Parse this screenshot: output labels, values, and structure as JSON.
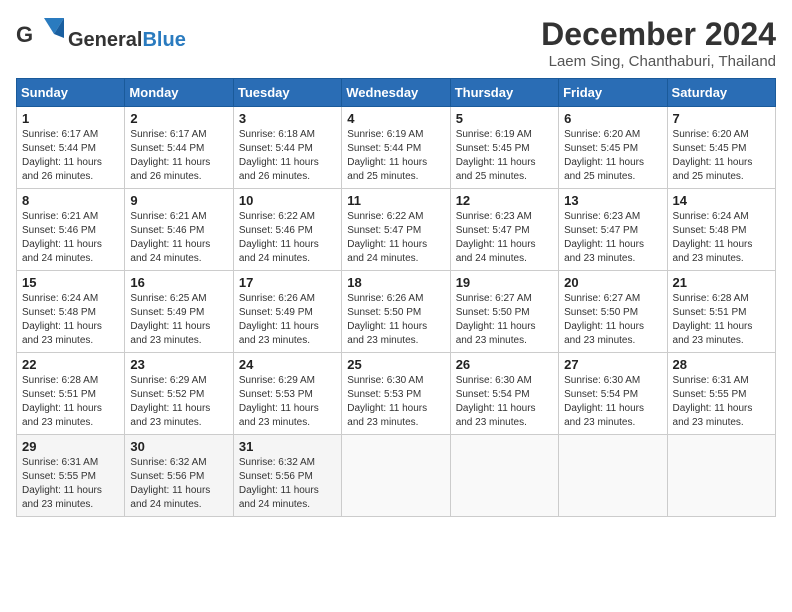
{
  "header": {
    "logo_general": "General",
    "logo_blue": "Blue",
    "month_year": "December 2024",
    "location": "Laem Sing, Chanthaburi, Thailand"
  },
  "calendar": {
    "days_of_week": [
      "Sunday",
      "Monday",
      "Tuesday",
      "Wednesday",
      "Thursday",
      "Friday",
      "Saturday"
    ],
    "weeks": [
      [
        {
          "day": "1",
          "info": "Sunrise: 6:17 AM\nSunset: 5:44 PM\nDaylight: 11 hours\nand 26 minutes."
        },
        {
          "day": "2",
          "info": "Sunrise: 6:17 AM\nSunset: 5:44 PM\nDaylight: 11 hours\nand 26 minutes."
        },
        {
          "day": "3",
          "info": "Sunrise: 6:18 AM\nSunset: 5:44 PM\nDaylight: 11 hours\nand 26 minutes."
        },
        {
          "day": "4",
          "info": "Sunrise: 6:19 AM\nSunset: 5:44 PM\nDaylight: 11 hours\nand 25 minutes."
        },
        {
          "day": "5",
          "info": "Sunrise: 6:19 AM\nSunset: 5:45 PM\nDaylight: 11 hours\nand 25 minutes."
        },
        {
          "day": "6",
          "info": "Sunrise: 6:20 AM\nSunset: 5:45 PM\nDaylight: 11 hours\nand 25 minutes."
        },
        {
          "day": "7",
          "info": "Sunrise: 6:20 AM\nSunset: 5:45 PM\nDaylight: 11 hours\nand 25 minutes."
        }
      ],
      [
        {
          "day": "8",
          "info": "Sunrise: 6:21 AM\nSunset: 5:46 PM\nDaylight: 11 hours\nand 24 minutes."
        },
        {
          "day": "9",
          "info": "Sunrise: 6:21 AM\nSunset: 5:46 PM\nDaylight: 11 hours\nand 24 minutes."
        },
        {
          "day": "10",
          "info": "Sunrise: 6:22 AM\nSunset: 5:46 PM\nDaylight: 11 hours\nand 24 minutes."
        },
        {
          "day": "11",
          "info": "Sunrise: 6:22 AM\nSunset: 5:47 PM\nDaylight: 11 hours\nand 24 minutes."
        },
        {
          "day": "12",
          "info": "Sunrise: 6:23 AM\nSunset: 5:47 PM\nDaylight: 11 hours\nand 24 minutes."
        },
        {
          "day": "13",
          "info": "Sunrise: 6:23 AM\nSunset: 5:47 PM\nDaylight: 11 hours\nand 23 minutes."
        },
        {
          "day": "14",
          "info": "Sunrise: 6:24 AM\nSunset: 5:48 PM\nDaylight: 11 hours\nand 23 minutes."
        }
      ],
      [
        {
          "day": "15",
          "info": "Sunrise: 6:24 AM\nSunset: 5:48 PM\nDaylight: 11 hours\nand 23 minutes."
        },
        {
          "day": "16",
          "info": "Sunrise: 6:25 AM\nSunset: 5:49 PM\nDaylight: 11 hours\nand 23 minutes."
        },
        {
          "day": "17",
          "info": "Sunrise: 6:26 AM\nSunset: 5:49 PM\nDaylight: 11 hours\nand 23 minutes."
        },
        {
          "day": "18",
          "info": "Sunrise: 6:26 AM\nSunset: 5:50 PM\nDaylight: 11 hours\nand 23 minutes."
        },
        {
          "day": "19",
          "info": "Sunrise: 6:27 AM\nSunset: 5:50 PM\nDaylight: 11 hours\nand 23 minutes."
        },
        {
          "day": "20",
          "info": "Sunrise: 6:27 AM\nSunset: 5:50 PM\nDaylight: 11 hours\nand 23 minutes."
        },
        {
          "day": "21",
          "info": "Sunrise: 6:28 AM\nSunset: 5:51 PM\nDaylight: 11 hours\nand 23 minutes."
        }
      ],
      [
        {
          "day": "22",
          "info": "Sunrise: 6:28 AM\nSunset: 5:51 PM\nDaylight: 11 hours\nand 23 minutes."
        },
        {
          "day": "23",
          "info": "Sunrise: 6:29 AM\nSunset: 5:52 PM\nDaylight: 11 hours\nand 23 minutes."
        },
        {
          "day": "24",
          "info": "Sunrise: 6:29 AM\nSunset: 5:53 PM\nDaylight: 11 hours\nand 23 minutes."
        },
        {
          "day": "25",
          "info": "Sunrise: 6:30 AM\nSunset: 5:53 PM\nDaylight: 11 hours\nand 23 minutes."
        },
        {
          "day": "26",
          "info": "Sunrise: 6:30 AM\nSunset: 5:54 PM\nDaylight: 11 hours\nand 23 minutes."
        },
        {
          "day": "27",
          "info": "Sunrise: 6:30 AM\nSunset: 5:54 PM\nDaylight: 11 hours\nand 23 minutes."
        },
        {
          "day": "28",
          "info": "Sunrise: 6:31 AM\nSunset: 5:55 PM\nDaylight: 11 hours\nand 23 minutes."
        }
      ],
      [
        {
          "day": "29",
          "info": "Sunrise: 6:31 AM\nSunset: 5:55 PM\nDaylight: 11 hours\nand 23 minutes."
        },
        {
          "day": "30",
          "info": "Sunrise: 6:32 AM\nSunset: 5:56 PM\nDaylight: 11 hours\nand 24 minutes."
        },
        {
          "day": "31",
          "info": "Sunrise: 6:32 AM\nSunset: 5:56 PM\nDaylight: 11 hours\nand 24 minutes."
        },
        {
          "day": "",
          "info": ""
        },
        {
          "day": "",
          "info": ""
        },
        {
          "day": "",
          "info": ""
        },
        {
          "day": "",
          "info": ""
        }
      ]
    ]
  }
}
